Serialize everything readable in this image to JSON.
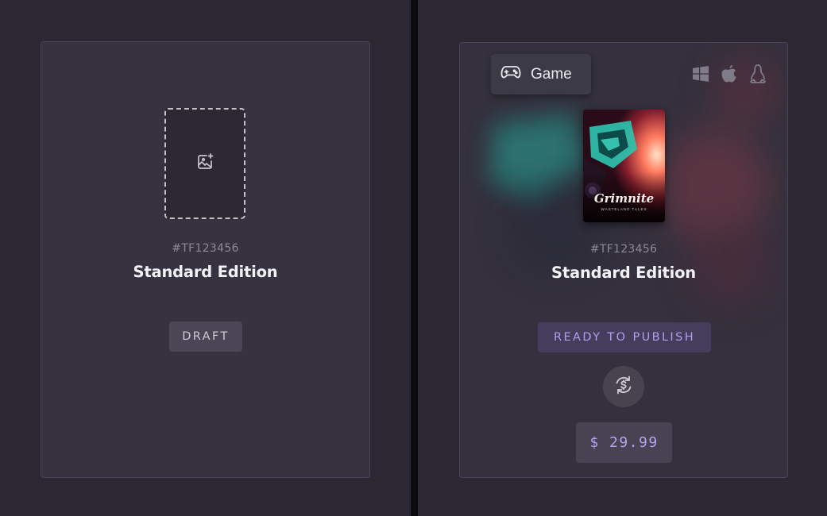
{
  "draft_card": {
    "sku": "#TF123456",
    "title": "Standard Edition",
    "status": "DRAFT",
    "image_icon": "add-image-icon"
  },
  "publish_card": {
    "type_label": "Game",
    "type_icon": "gamepad-icon",
    "platform_icons": [
      "windows-icon",
      "apple-icon",
      "linux-icon"
    ],
    "cover": {
      "title": "Grimnite",
      "subtitle": "WASTELAND TALES"
    },
    "sku": "#TF123456",
    "title": "Standard Edition",
    "status": "READY TO PUBLISH",
    "refresh_icon": "currency-refresh-icon",
    "price": "$ 29.99"
  },
  "colors": {
    "background": "#2b2833",
    "card": "#36323f",
    "accent": "#b39df0"
  }
}
